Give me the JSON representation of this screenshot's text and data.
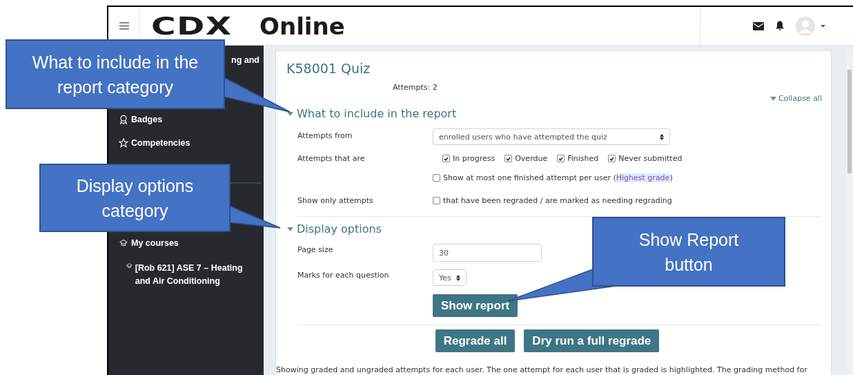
{
  "navbar": {
    "logo": {
      "mark": "CDX",
      "word": "Online"
    }
  },
  "sidebar": {
    "items": [
      {
        "kind": "cut",
        "label": "ng and"
      },
      {
        "kind": "badge",
        "label": "Badges"
      },
      {
        "kind": "star",
        "label": "Competencies"
      },
      {
        "kind": "section",
        "label": "My courses",
        "children": [
          {
            "kind": "course",
            "label": "[Rob 621] ASE 7 – Heating and Air Conditioning"
          }
        ]
      }
    ]
  },
  "page": {
    "title": "K58001 Quiz",
    "attempts": "Attempts: 2",
    "collapse_all": "Collapse all",
    "sections": [
      {
        "title": "What to include in the report",
        "expanded": true,
        "rows": [
          {
            "kind": "select",
            "label": "Attempts from",
            "value": "enrolled users who have attempted the quiz"
          },
          {
            "kind": "checks",
            "label": "Attempts that are",
            "options": [
              {
                "label": "In progress",
                "checked": true
              },
              {
                "label": "Overdue",
                "checked": true
              },
              {
                "label": "Finished",
                "checked": true
              },
              {
                "label": "Never submitted",
                "checked": true
              }
            ]
          },
          {
            "kind": "check",
            "label": "",
            "option": {
              "label": "Show at most one finished attempt per user (",
              "link": "Highest grade",
              "after": ")",
              "checked": false
            }
          },
          {
            "kind": "check",
            "label": "Show only attempts",
            "option": {
              "label": "that have been regraded / are marked as needing regrading",
              "checked": false
            }
          }
        ]
      },
      {
        "title": "Display options",
        "expanded": true,
        "rows": [
          {
            "kind": "input",
            "label": "Page size",
            "value": "30"
          },
          {
            "kind": "smallselect",
            "label": "Marks for each question",
            "value": "Yes"
          }
        ]
      }
    ],
    "submit": "Show report",
    "actions": [
      "Regrade all",
      "Dry run a full regrade"
    ],
    "note": "Showing graded and ungraded attempts for each user. The one attempt for each user that is graded is highlighted. The grading method for"
  },
  "callouts": [
    {
      "text": "What to include in the report category"
    },
    {
      "text": "Display options category"
    },
    {
      "text": "Show Report button"
    }
  ]
}
